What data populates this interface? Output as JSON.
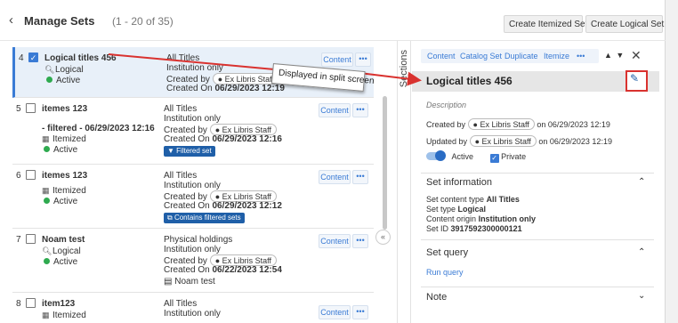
{
  "header": {
    "back_icon": "chevron-left-icon",
    "title": "Manage Sets",
    "count": "(1 - 20 of 35)",
    "create_itemized": "Create Itemized Set",
    "create_logical": "Create Logical Set"
  },
  "rows": [
    {
      "index": "4",
      "name": "Logical titles 456",
      "type": "Logical",
      "status": "Active",
      "content": "All Titles",
      "scope": "Institution only",
      "created_by_prefix": "Created by",
      "created_by": "Ex Libris Staff",
      "created_on_prefix": "Created On",
      "created_on": "06/29/2023 12:19",
      "content_btn": "Content",
      "more_btn": "•••"
    },
    {
      "index": "5",
      "name": "itemes 123",
      "filtered": "- filtered - 06/29/2023 12:16",
      "type": "Itemized",
      "status": "Active",
      "content": "All Titles",
      "scope": "Institution only",
      "created_by_prefix": "Created by",
      "created_by": "Ex Libris Staff",
      "created_on_prefix": "Created On",
      "created_on": "06/29/2023 12:16",
      "tag": "Filtered set",
      "content_btn": "Content",
      "more_btn": "•••"
    },
    {
      "index": "6",
      "name": "itemes 123",
      "type": "Itemized",
      "status": "Active",
      "content": "All Titles",
      "scope": "Institution only",
      "created_by_prefix": "Created by",
      "created_by": "Ex Libris Staff",
      "created_on_prefix": "Created On",
      "created_on": "06/29/2023 12:12",
      "tag": "Contains filtered sets",
      "content_btn": "Content",
      "more_btn": "•••"
    },
    {
      "index": "7",
      "name": "Noam test",
      "type": "Logical",
      "status": "Active",
      "content": "Physical holdings",
      "scope": "Institution only",
      "created_by_prefix": "Created by",
      "created_by": "Ex Libris Staff",
      "created_on_prefix": "Created On",
      "created_on": "06/22/2023 12:54",
      "note": "Noam test",
      "content_btn": "Content",
      "more_btn": "•••"
    },
    {
      "index": "8",
      "name": "item123",
      "type": "Itemized",
      "content": "All Titles",
      "scope": "Institution only",
      "content_btn": "Content",
      "more_btn": "•••"
    }
  ],
  "sections_label": "Sections",
  "collapse_icon": "double-chevron-left-icon",
  "detail": {
    "toolbar": [
      "Content",
      "Catalog Set",
      "Duplicate",
      "Itemize",
      "•••"
    ],
    "nav_arrows": "▲ ▼",
    "close": "✕",
    "title": "Logical titles 456",
    "edit_icon": "pencil-icon",
    "description": "Description",
    "created_prefix": "Created by",
    "created_by": "Ex Libris Staff",
    "created_suffix": "on 06/29/2023 12:19",
    "updated_prefix": "Updated by",
    "updated_by": "Ex Libris Staff",
    "updated_suffix": "on 06/29/2023 12:19",
    "active_label": "Active",
    "private_label": "Private",
    "set_info_title": "Set information",
    "info_lines": [
      {
        "label": "Set content type",
        "value": "All Titles"
      },
      {
        "label": "Set type",
        "value": "Logical"
      },
      {
        "label": "Content origin",
        "value": "Institution only"
      },
      {
        "label": "Set ID",
        "value": "3917592300000121"
      }
    ],
    "set_query_title": "Set query",
    "run_query": "Run query",
    "note_title": "Note"
  },
  "annotation": {
    "callout": "Displayed in split screen",
    "arrow_color": "#d9322f"
  }
}
